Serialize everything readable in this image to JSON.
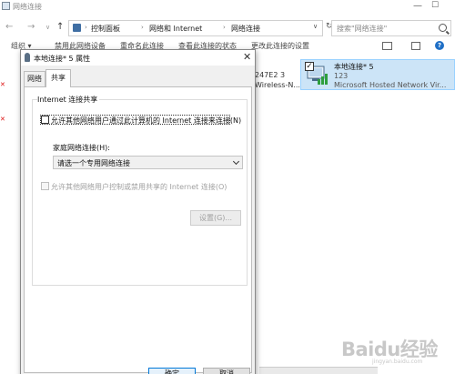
{
  "explorer": {
    "title": "网络连接",
    "breadcrumbs": [
      "控制面板",
      "网络和 Internet",
      "网络连接"
    ],
    "search_placeholder": "搜索\"网络连接\"",
    "commands": [
      "组织 ▾",
      "禁用此网络设备",
      "重命名此连接",
      "查看此连接的状态",
      "更改此连接的设置"
    ],
    "adapter_partial": [
      "247E2  3",
      "Wireless-N..."
    ],
    "selected_adapter": {
      "name": "本地连接* 5",
      "sub1": "123",
      "sub2": "Microsoft Hosted Network Vir..."
    }
  },
  "dialog": {
    "title": "本地连接* 5 属性",
    "tabs": [
      "网络",
      "共享"
    ],
    "group_title": "Internet 连接共享",
    "allow_share_label": "允许其他网络用户通过此计算机的 Internet 连接来连接(N)",
    "home_network_label": "家庭网络连接(H):",
    "home_network_value": "请选一个专用网络连接",
    "allow_control_label": "允许其他网络用户控制或禁用共享的 Internet 连接(O)",
    "settings_label": "设置(G)...",
    "ok_label": "确定",
    "cancel_label": "取消"
  },
  "watermark": {
    "brand": "Baidu经验",
    "url": "jingyan.baidu.com"
  }
}
